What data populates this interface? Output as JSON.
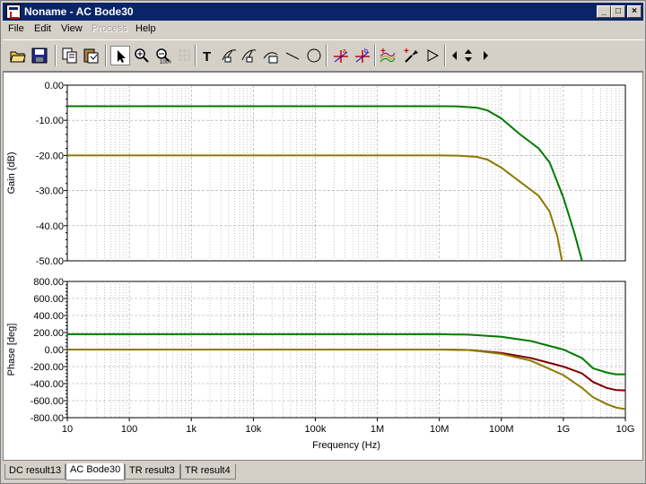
{
  "window": {
    "title": "Noname - AC Bode30"
  },
  "menu": [
    {
      "label": "File",
      "enabled": true
    },
    {
      "label": "Edit",
      "enabled": true
    },
    {
      "label": "View",
      "enabled": true
    },
    {
      "label": "Process",
      "enabled": false
    },
    {
      "label": "Help",
      "enabled": true
    }
  ],
  "toolbar": {
    "tools": [
      "open-icon",
      "save-icon",
      "copy-icon",
      "paste-icon",
      "pointer-icon",
      "zoom-in-icon",
      "zoom-out-icon",
      "grid-icon",
      "text-icon",
      "label-icon",
      "label-alt-icon",
      "comment-icon",
      "line-icon",
      "circle-icon",
      "cursor-a-icon",
      "cursor-b-icon",
      "add-curve-icon",
      "add-cursor-icon",
      "marker-icon",
      "arrow-left-icon",
      "arrow-updown-icon",
      "arrow-right-icon"
    ]
  },
  "colors": {
    "green": "#007a00",
    "olive": "#8c7a00",
    "dark_red": "#800000",
    "grid": "#a0a0a0"
  },
  "chart_data": [
    {
      "type": "line",
      "title": "",
      "ylabel": "Gain (dB)",
      "xlabel": "",
      "x_scale": "log",
      "xlim": [
        10,
        10000000000
      ],
      "ylim": [
        -50,
        0
      ],
      "y_ticks": [
        "0.00",
        "-10.00",
        "-20.00",
        "-30.00",
        "-40.00",
        "-50.00"
      ],
      "series": [
        {
          "color": "green",
          "points": [
            [
              10,
              -6
            ],
            [
              1000000,
              -6
            ],
            [
              10000000,
              -6
            ],
            [
              20000000,
              -6.05
            ],
            [
              40000000,
              -6.4
            ],
            [
              60000000,
              -7.2
            ],
            [
              100000000,
              -9.5
            ],
            [
              200000000,
              -14
            ],
            [
              400000000,
              -18
            ],
            [
              600000000,
              -22
            ],
            [
              1000000000,
              -32
            ],
            [
              1500000000,
              -42
            ],
            [
              2000000000,
              -50
            ]
          ]
        },
        {
          "color": "olive",
          "points": [
            [
              10,
              -20
            ],
            [
              1000000,
              -20
            ],
            [
              10000000,
              -20
            ],
            [
              20000000,
              -20.05
            ],
            [
              40000000,
              -20.4
            ],
            [
              60000000,
              -21.2
            ],
            [
              100000000,
              -23.5
            ],
            [
              200000000,
              -27.5
            ],
            [
              400000000,
              -31.5
            ],
            [
              600000000,
              -36
            ],
            [
              800000000,
              -43
            ],
            [
              950000000,
              -50
            ]
          ]
        }
      ]
    },
    {
      "type": "line",
      "title": "",
      "ylabel": "Phase [deg]",
      "xlabel": "Frequency (Hz)",
      "x_scale": "log",
      "xlim": [
        10,
        10000000000
      ],
      "ylim": [
        -800,
        800
      ],
      "y_ticks": [
        "800.00",
        "600.00",
        "400.00",
        "200.00",
        "0.00",
        "-200.00",
        "-400.00",
        "-600.00",
        "-800.00"
      ],
      "x_ticks": [
        "10",
        "100",
        "1k",
        "10k",
        "100k",
        "1M",
        "10M",
        "100M",
        "1G",
        "10G"
      ],
      "series": [
        {
          "color": "green",
          "points": [
            [
              10,
              180
            ],
            [
              1000000,
              180
            ],
            [
              10000000,
              180
            ],
            [
              30000000,
              175
            ],
            [
              100000000,
              150
            ],
            [
              300000000,
              100
            ],
            [
              1000000000,
              0
            ],
            [
              2000000000,
              -100
            ],
            [
              3000000000,
              -220
            ],
            [
              5000000000,
              -270
            ],
            [
              7000000000,
              -290
            ],
            [
              10000000000,
              -290
            ]
          ]
        },
        {
          "color": "dark_red",
          "points": [
            [
              10,
              0
            ],
            [
              1000000,
              0
            ],
            [
              10000000,
              0
            ],
            [
              30000000,
              -5
            ],
            [
              100000000,
              -40
            ],
            [
              300000000,
              -100
            ],
            [
              1000000000,
              -200
            ],
            [
              2000000000,
              -280
            ],
            [
              3000000000,
              -380
            ],
            [
              5000000000,
              -450
            ],
            [
              7000000000,
              -475
            ],
            [
              10000000000,
              -480
            ]
          ]
        },
        {
          "color": "olive",
          "points": [
            [
              10,
              0
            ],
            [
              1000000,
              0
            ],
            [
              10000000,
              0
            ],
            [
              30000000,
              -5
            ],
            [
              100000000,
              -50
            ],
            [
              300000000,
              -130
            ],
            [
              1000000000,
              -300
            ],
            [
              2000000000,
              -450
            ],
            [
              3000000000,
              -560
            ],
            [
              5000000000,
              -640
            ],
            [
              7000000000,
              -680
            ],
            [
              10000000000,
              -700
            ]
          ]
        }
      ]
    }
  ],
  "tabs": [
    {
      "label": "DC result13",
      "active": false
    },
    {
      "label": "AC Bode30",
      "active": true
    },
    {
      "label": "TR result3",
      "active": false
    },
    {
      "label": "TR result4",
      "active": false
    }
  ]
}
